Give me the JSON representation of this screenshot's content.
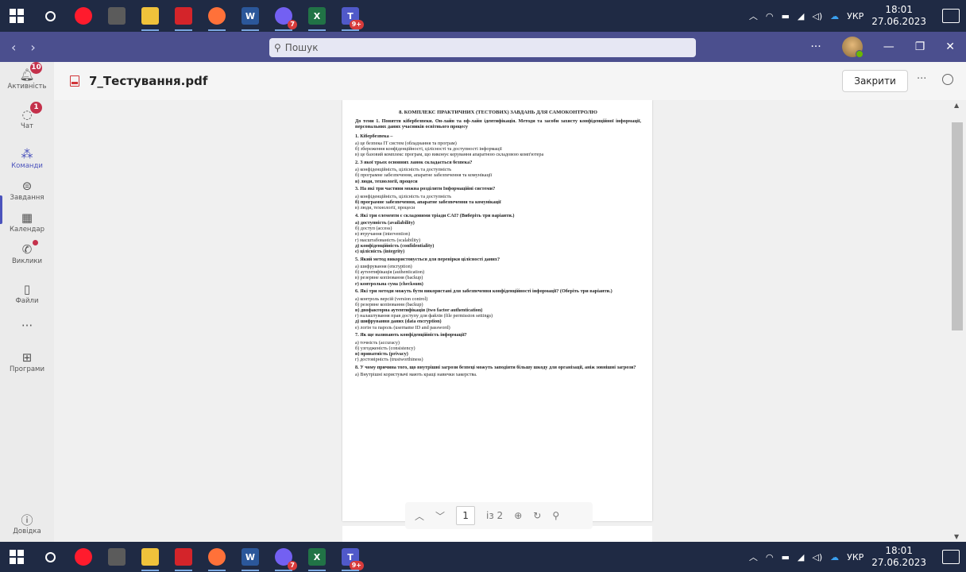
{
  "taskbar": {
    "apps": [
      {
        "name": "windows-start",
        "color": "#ffffff",
        "label": ""
      },
      {
        "name": "search",
        "color": "",
        "label": ""
      },
      {
        "name": "opera",
        "color": "#ff1b2d",
        "label": ""
      },
      {
        "name": "calculator",
        "color": "#5b5b5b",
        "label": ""
      },
      {
        "name": "file-explorer",
        "color": "#f0c23b",
        "label": ""
      },
      {
        "name": "acrobat",
        "color": "#d4242a",
        "label": ""
      },
      {
        "name": "firefox",
        "color": "#ff7139",
        "label": ""
      },
      {
        "name": "word",
        "color": "#2b579a",
        "label": "W"
      },
      {
        "name": "viber",
        "color": "#7360f2",
        "label": "",
        "badge": "7"
      },
      {
        "name": "excel",
        "color": "#217346",
        "label": "X"
      },
      {
        "name": "teams",
        "color": "#5059c9",
        "label": "T",
        "badge": "9+"
      }
    ],
    "lang": "УКР",
    "time": "18:01",
    "date": "27.06.2023"
  },
  "titlebar": {
    "search_placeholder": "Пошук",
    "more": "···"
  },
  "rail": {
    "items": [
      {
        "key": "activity",
        "label": "Активність",
        "badge": "10"
      },
      {
        "key": "chat",
        "label": "Чат",
        "badge": "1"
      },
      {
        "key": "teams",
        "label": "Команди",
        "badge": ""
      },
      {
        "key": "assignments",
        "label": "Завдання",
        "badge": ""
      },
      {
        "key": "calendar",
        "label": "Календар",
        "badge": ""
      },
      {
        "key": "calls",
        "label": "Виклики",
        "badge": ""
      },
      {
        "key": "files",
        "label": "Файли",
        "badge": ""
      },
      {
        "key": "more",
        "label": "",
        "badge": ""
      },
      {
        "key": "apps",
        "label": "Програми",
        "badge": ""
      },
      {
        "key": "help",
        "label": "Довідка",
        "badge": ""
      }
    ]
  },
  "header": {
    "title": "7_Тестування.pdf",
    "close_label": "Закрити",
    "more": "···"
  },
  "pdf": {
    "heading": "8. КОМПЛЕКС ПРАКТИЧНИХ (ТЕСТОВИХ) ЗАВДАНЬ ДЛЯ САМОКОНТРОЛЮ",
    "subtitle": "До теми 1. Поняття кібербезпеки. Он-лайн та оф-лайн ідентифікація. Методи та засоби захисту конфіденційної інформації, персональних даних учасників освітнього процесу",
    "questions": [
      {
        "q": "1. Кібербезпека –",
        "options": [
          {
            "t": "а) це безпека ІТ систем (обладнання та програм)",
            "b": false
          },
          {
            "t": "б) збереження конфіденційності, цілісності та доступності інформації",
            "b": false
          },
          {
            "t": "в) це базовий комплекс програм, що виконує керування апаратною складовою комп'ютера",
            "b": false
          }
        ]
      },
      {
        "q": "2. З якої трьох основних ланок складається безпека?",
        "options": [
          {
            "t": "а) конфіденційність, цілісність та доступність",
            "b": false
          },
          {
            "t": "б) програмне забезпечення, апаратне забезпечення та комунікації",
            "b": false
          },
          {
            "t": "в) люди, технології, процеси",
            "b": true
          }
        ]
      },
      {
        "q": "3. На які три частини можна розділити Інформаційні системи?",
        "options": [
          {
            "t": "а) конфіденційність, цілісність та доступність",
            "b": false
          },
          {
            "t": "б) програмне забезпечення, апаратне забезпечення та комунікації",
            "b": true
          },
          {
            "t": "в) люди, технології, процеси",
            "b": false
          }
        ]
      },
      {
        "q": "4. Які три елементи є складовими тріади CAI? (Виберіть три варіанти.)",
        "options": [
          {
            "t": "а) доступність (availability)",
            "b": true
          },
          {
            "t": "б) доступ (access)",
            "b": false
          },
          {
            "t": "в) втручання (intervention)",
            "b": false
          },
          {
            "t": "г) масштабованість (scalability)",
            "b": false
          },
          {
            "t": "д) конфіденційність (confidentiality)",
            "b": true
          },
          {
            "t": "є) цілісність (integrity)",
            "b": true
          }
        ]
      },
      {
        "q": "5. Який метод використовується для перевірки цілісності даних?",
        "options": [
          {
            "t": "а) шифрування (encryption)",
            "b": false
          },
          {
            "t": "б) аутентифікація (authentication)",
            "b": false
          },
          {
            "t": "в) резервне копіювання (backup)",
            "b": false
          },
          {
            "t": "г) контрольна сума (checksum)",
            "b": true
          }
        ]
      },
      {
        "q": "6. Які три методи можуть бути використані для забезпечення конфіденційності інформації? (Оберіть три варіанти.)",
        "options": [
          {
            "t": "а) контроль версій (version control)",
            "b": false
          },
          {
            "t": "б) резервне копіювання (backup)",
            "b": false
          },
          {
            "t": "в) двофакторна аутентифікація (two factor authentication)",
            "b": true
          },
          {
            "t": "г) налаштування прав доступу для файлів (file permission settings)",
            "b": false
          },
          {
            "t": "д) шифрування даних (data encryption)",
            "b": true
          },
          {
            "t": "е) логін та пароль (username ID and password)",
            "b": false
          }
        ]
      },
      {
        "q": "7. Як ще називають конфіденційність інформації?",
        "options": [
          {
            "t": "а) точність (accuracy)",
            "b": false
          },
          {
            "t": "б) узгодженість (consistency)",
            "b": false
          },
          {
            "t": "в) приватність (privacy)",
            "b": true
          },
          {
            "t": "г) достовірність (trustworthiness)",
            "b": false
          }
        ]
      },
      {
        "q": "8. У чому причина того, що внутрішні загрози безпеці можуть заподіяти більшу шкоду для організації, аніж зовнішні загрози?",
        "options": [
          {
            "t": "а) Внутрішні користувачі мають кращі навички хакерства.",
            "b": false
          }
        ]
      }
    ]
  },
  "pager": {
    "current_page": "1",
    "total": "із 2"
  }
}
